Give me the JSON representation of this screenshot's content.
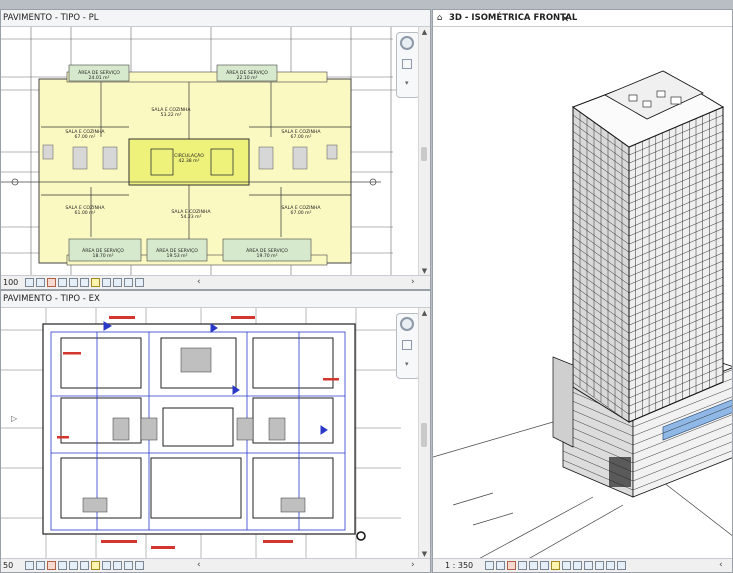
{
  "views": {
    "top_left": {
      "title": "PAVIMENTO - TIPO - PL",
      "scale": "100"
    },
    "bottom_left": {
      "title": "PAVIMENTO - TIPO - EX",
      "scale": "50"
    },
    "right": {
      "title": "3D - ISOMÉTRICA FRONTAL",
      "scale": "1 : 350",
      "close_glyph": "✕"
    }
  },
  "rooms": [
    {
      "name": "ÁREA DE SERVIÇO",
      "area": "24.01 m²"
    },
    {
      "name": "ÁREA DE SERVIÇO",
      "area": "22.10 m²"
    },
    {
      "name": "SALA E COZINHA",
      "area": "53.22 m²"
    },
    {
      "name": "SALA E COZINHA",
      "area": "67.00 m²"
    },
    {
      "name": "SALA E COZINHA",
      "area": "67.00 m²"
    },
    {
      "name": "CIRCULAÇÃO",
      "area": "42.38 m²"
    },
    {
      "name": "SALA E COZINHA",
      "area": "61.00 m²"
    },
    {
      "name": "SALA E COZINHA",
      "area": "67.00 m²"
    },
    {
      "name": "SALA E COZINHA",
      "area": "54.23 m²"
    },
    {
      "name": "ÁREA DE SERVIÇO",
      "area": "18.70 m²"
    },
    {
      "name": "ÁREA DE SERVIÇO",
      "area": "19.53 m²"
    },
    {
      "name": "ÁREA DE SERVIÇO",
      "area": "19.70 m²"
    }
  ],
  "colors": {
    "floor": "#fbf9c2",
    "core": "#eef27a",
    "annotation_red": "#d2362f",
    "annotation_blue": "#2b39c8"
  }
}
